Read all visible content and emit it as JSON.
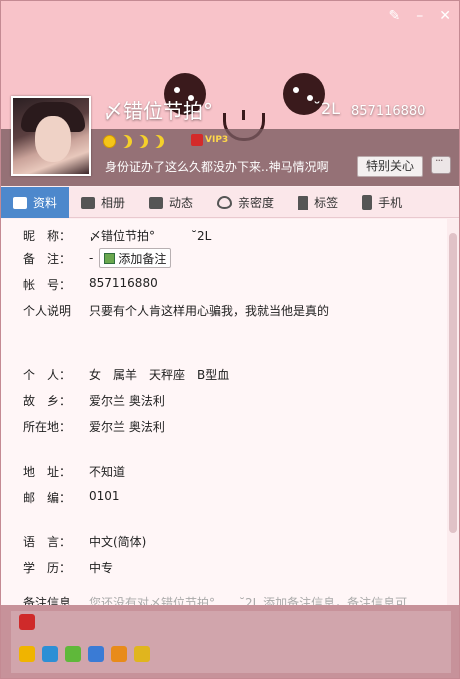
{
  "profile": {
    "nickname": "〆错位节拍°",
    "nickname_tail": "˘2L",
    "qq_number": "857116880",
    "vip_label": "VIP3",
    "signature": "身份证办了这么久都没办下来..神马情况啊",
    "special_care_label": "特别关心"
  },
  "tabs": [
    {
      "label": "资料",
      "icon": "profile-card-icon",
      "active": true
    },
    {
      "label": "相册",
      "icon": "photo-album-icon"
    },
    {
      "label": "动态",
      "icon": "feed-list-icon"
    },
    {
      "label": "亲密度",
      "icon": "heart-icon"
    },
    {
      "label": "标签",
      "icon": "bookmark-icon"
    },
    {
      "label": "手机",
      "icon": "phone-icon"
    }
  ],
  "info": {
    "nickname_key": "昵　称：",
    "nickname_val": "〆错位节拍°　　　˘2L",
    "remark_key": "备　注：",
    "remark_val": "-",
    "add_remark_label": "添加备注",
    "account_key": "帐　号：",
    "account_val": "857116880",
    "desc_key": "个人说明",
    "desc_val": "只要有个人肯这样用心骗我，我就当他是真的",
    "personal_key": "个　人：",
    "personal_val": "女　属羊　天秤座　B型血",
    "hometown_key": "故　乡：",
    "hometown_val": "爱尔兰 奥法利",
    "location_key": "所在地：",
    "location_val": "爱尔兰 奥法利",
    "address_key": "地　址：",
    "address_val": "不知道",
    "postcode_key": "邮　编：",
    "postcode_val": "0101",
    "language_key": "语　言：",
    "language_val": "中文(简体)",
    "education_key": "学　历：",
    "education_val": "中专",
    "remark_info_key": "备注信息",
    "remark_info_val": "您还没有对〆错位节拍°　　˘2L 添加备注信息，备注信息可"
  },
  "colors": {
    "banner": "#f8c3c9",
    "tab_active": "#4d88cc",
    "bottom": "#c7929a"
  }
}
